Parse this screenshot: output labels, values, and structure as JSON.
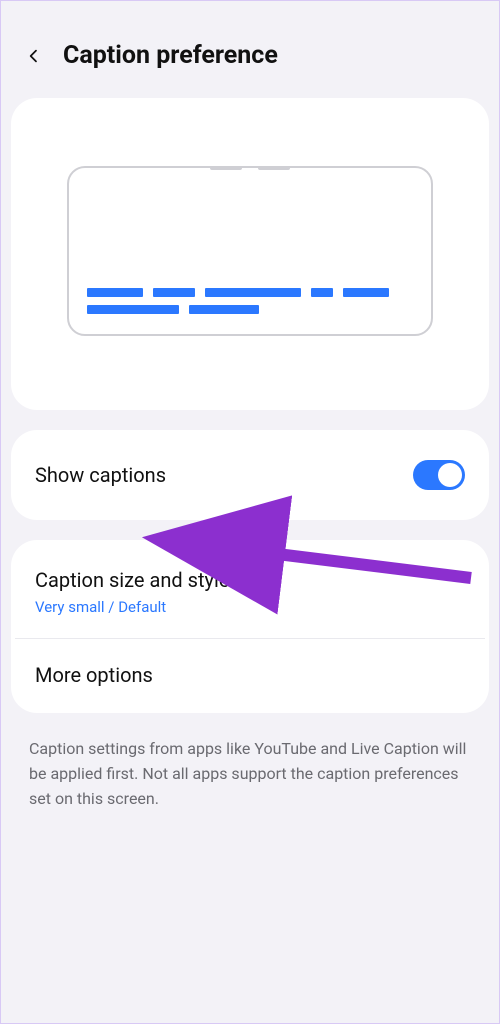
{
  "header": {
    "title": "Caption preference"
  },
  "show_captions": {
    "label": "Show captions",
    "on": true
  },
  "caption_style": {
    "title": "Caption size and style",
    "subtitle": "Very small / Default"
  },
  "more_options": {
    "title": "More options"
  },
  "footnote": "Caption settings from apps like YouTube and Live Caption will be applied first. Not all apps support the caption preferences set on this screen.",
  "colors": {
    "accent": "#2b78ff",
    "annotation": "#8c2fcf"
  }
}
